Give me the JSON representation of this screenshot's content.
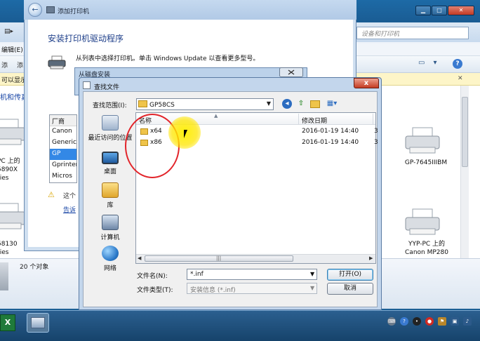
{
  "background_window": {
    "search_placeholder": "设备和打印机",
    "menu_edit": "编辑(E)",
    "toolbar_mark_1": "添",
    "toolbar_mark_2": "添",
    "infobar_text": "可以显示",
    "left_link": "机和传真",
    "status_count": "20 个对象",
    "devices_left": [
      {
        "label_1": "PC 上的",
        "label_2": "5890X",
        "label_3": "ries"
      },
      {
        "label_1": "58130",
        "label_2": "ries"
      }
    ],
    "devices_right": [
      {
        "label_1": "GP-7645IIIBM"
      },
      {
        "label_1": "YYP-PC 上的",
        "label_2": "Canon MP280"
      }
    ]
  },
  "wizard": {
    "title": "添加打印机",
    "heading": "安装打印机驱动程序",
    "description": "从列表中选择打印机。单击 Windows Update 以查看更多型号。",
    "manufacturer_header": "厂商",
    "manufacturers": [
      "Canon",
      "Generic",
      "GP",
      "Gprinter",
      "Micros"
    ],
    "selected_manufacturer_index": 2,
    "warning_text": "这个",
    "driver_link": "告诉"
  },
  "disk_dialog": {
    "title": "从磁盘安装"
  },
  "browse_dialog": {
    "title": "查找文件",
    "close_label": "x",
    "lookin_label": "查找范围(I):",
    "lookin_value": "GP58CS",
    "places": [
      {
        "label": "最近访问的位置",
        "icon": "recent-places-icon"
      },
      {
        "label": "桌面",
        "icon": "desktop-icon"
      },
      {
        "label": "库",
        "icon": "library-icon"
      },
      {
        "label": "计算机",
        "icon": "computer-icon"
      },
      {
        "label": "网络",
        "icon": "network-icon"
      }
    ],
    "columns": {
      "name": "名称",
      "date": "修改日期"
    },
    "files": [
      {
        "name": "x64",
        "date": "2016-01-19 14:40",
        "type": "3"
      },
      {
        "name": "x86",
        "date": "2016-01-19 14:40",
        "type": "3"
      }
    ],
    "filename_label": "文件名(N):",
    "filename_value": "*.inf",
    "filetype_label": "文件类型(T):",
    "filetype_value": "安装信息 (*.inf)",
    "open_label": "打开(O)",
    "cancel_label": "取消"
  },
  "taskbar": {
    "excel_glyph": "X"
  },
  "colors": {
    "titlebar": "#1d6aa6",
    "selection": "#3388e6",
    "annotation_circle": "#e2242a",
    "cursor_highlight": "#ffee00"
  }
}
